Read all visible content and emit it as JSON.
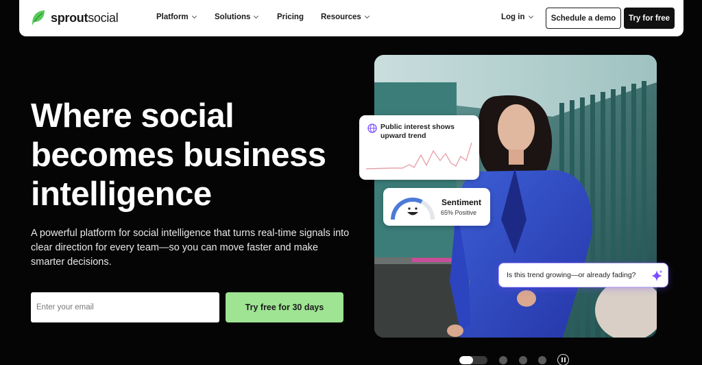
{
  "nav": {
    "logo_text_bold": "sprout",
    "logo_text_light": "social",
    "items": [
      {
        "label": "Platform",
        "dropdown": true
      },
      {
        "label": "Solutions",
        "dropdown": true
      },
      {
        "label": "Pricing",
        "dropdown": false
      },
      {
        "label": "Resources",
        "dropdown": true
      }
    ],
    "login_label": "Log in",
    "demo_label": "Schedule a demo",
    "try_label": "Try for free"
  },
  "hero": {
    "headline": "Where social becomes business intelligence",
    "subtext": "A powerful platform for social intelligence that turns real-time signals into clear direction for every team—so you can move faster and make smarter decisions.",
    "email_placeholder": "Enter your email",
    "cta_label": "Try free for 30 days"
  },
  "cards": {
    "trend_title": "Public interest shows upward trend",
    "sentiment_label": "Sentiment",
    "sentiment_value": "65% Positive",
    "sentiment_fraction": 0.65,
    "question": "Is this trend growing—or already fading?"
  },
  "carousel": {
    "slide_count": 4,
    "active_index": 0
  },
  "colors": {
    "brand_green": "#59cb59",
    "cta_green": "#9ee493",
    "background": "#050505",
    "sparkline": "#e6a3ad",
    "ai_purple": "#7b4dff"
  },
  "icons": [
    "sprout-logo-icon",
    "chevron-down-icon",
    "globe-icon",
    "smiley-icon",
    "sparkle-icon",
    "pause-icon"
  ]
}
